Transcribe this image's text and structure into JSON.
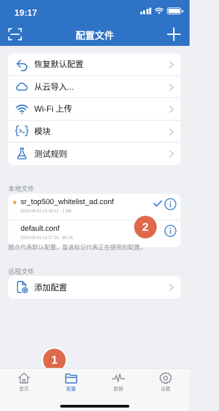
{
  "status_bar": {
    "time": "19:17"
  },
  "header": {
    "title": "配置文件"
  },
  "menu": {
    "items": [
      {
        "label": "恢复默认配置",
        "icon": "restore-icon"
      },
      {
        "label": "从云导入...",
        "icon": "cloud-icon"
      },
      {
        "label": "Wi-Fi 上传",
        "icon": "wifi-icon"
      },
      {
        "label": "模块",
        "icon": "module-icon"
      },
      {
        "label": "测试规则",
        "icon": "flask-icon"
      }
    ]
  },
  "local": {
    "section_label": "本地文件",
    "files": [
      {
        "name": "sr_top500_whitelist_ad.conf",
        "meta": "2023-04-02 21:18:12 · 1.9M",
        "is_default": true,
        "in_use": true
      },
      {
        "name": "default.conf",
        "meta": "2023-04-02 21:17:22 · 90.1K",
        "is_default": false,
        "in_use": false
      }
    ],
    "hint": "圆点代表默认配置，复选标记代表正在使用的配置。"
  },
  "remote": {
    "section_label": "远程文件",
    "add_label": "添加配置"
  },
  "annotations": {
    "badge_1": "1",
    "badge_2": "2"
  },
  "tabs": [
    {
      "label": "首页",
      "icon": "home-icon",
      "active": false
    },
    {
      "label": "配置",
      "icon": "folder-icon",
      "active": true
    },
    {
      "label": "数据",
      "icon": "pulse-icon",
      "active": false
    },
    {
      "label": "设置",
      "icon": "settings-icon",
      "active": false
    }
  ],
  "colors": {
    "accent": "#2f73c7",
    "dot": "#f2a63a",
    "badge": "#de694a"
  }
}
